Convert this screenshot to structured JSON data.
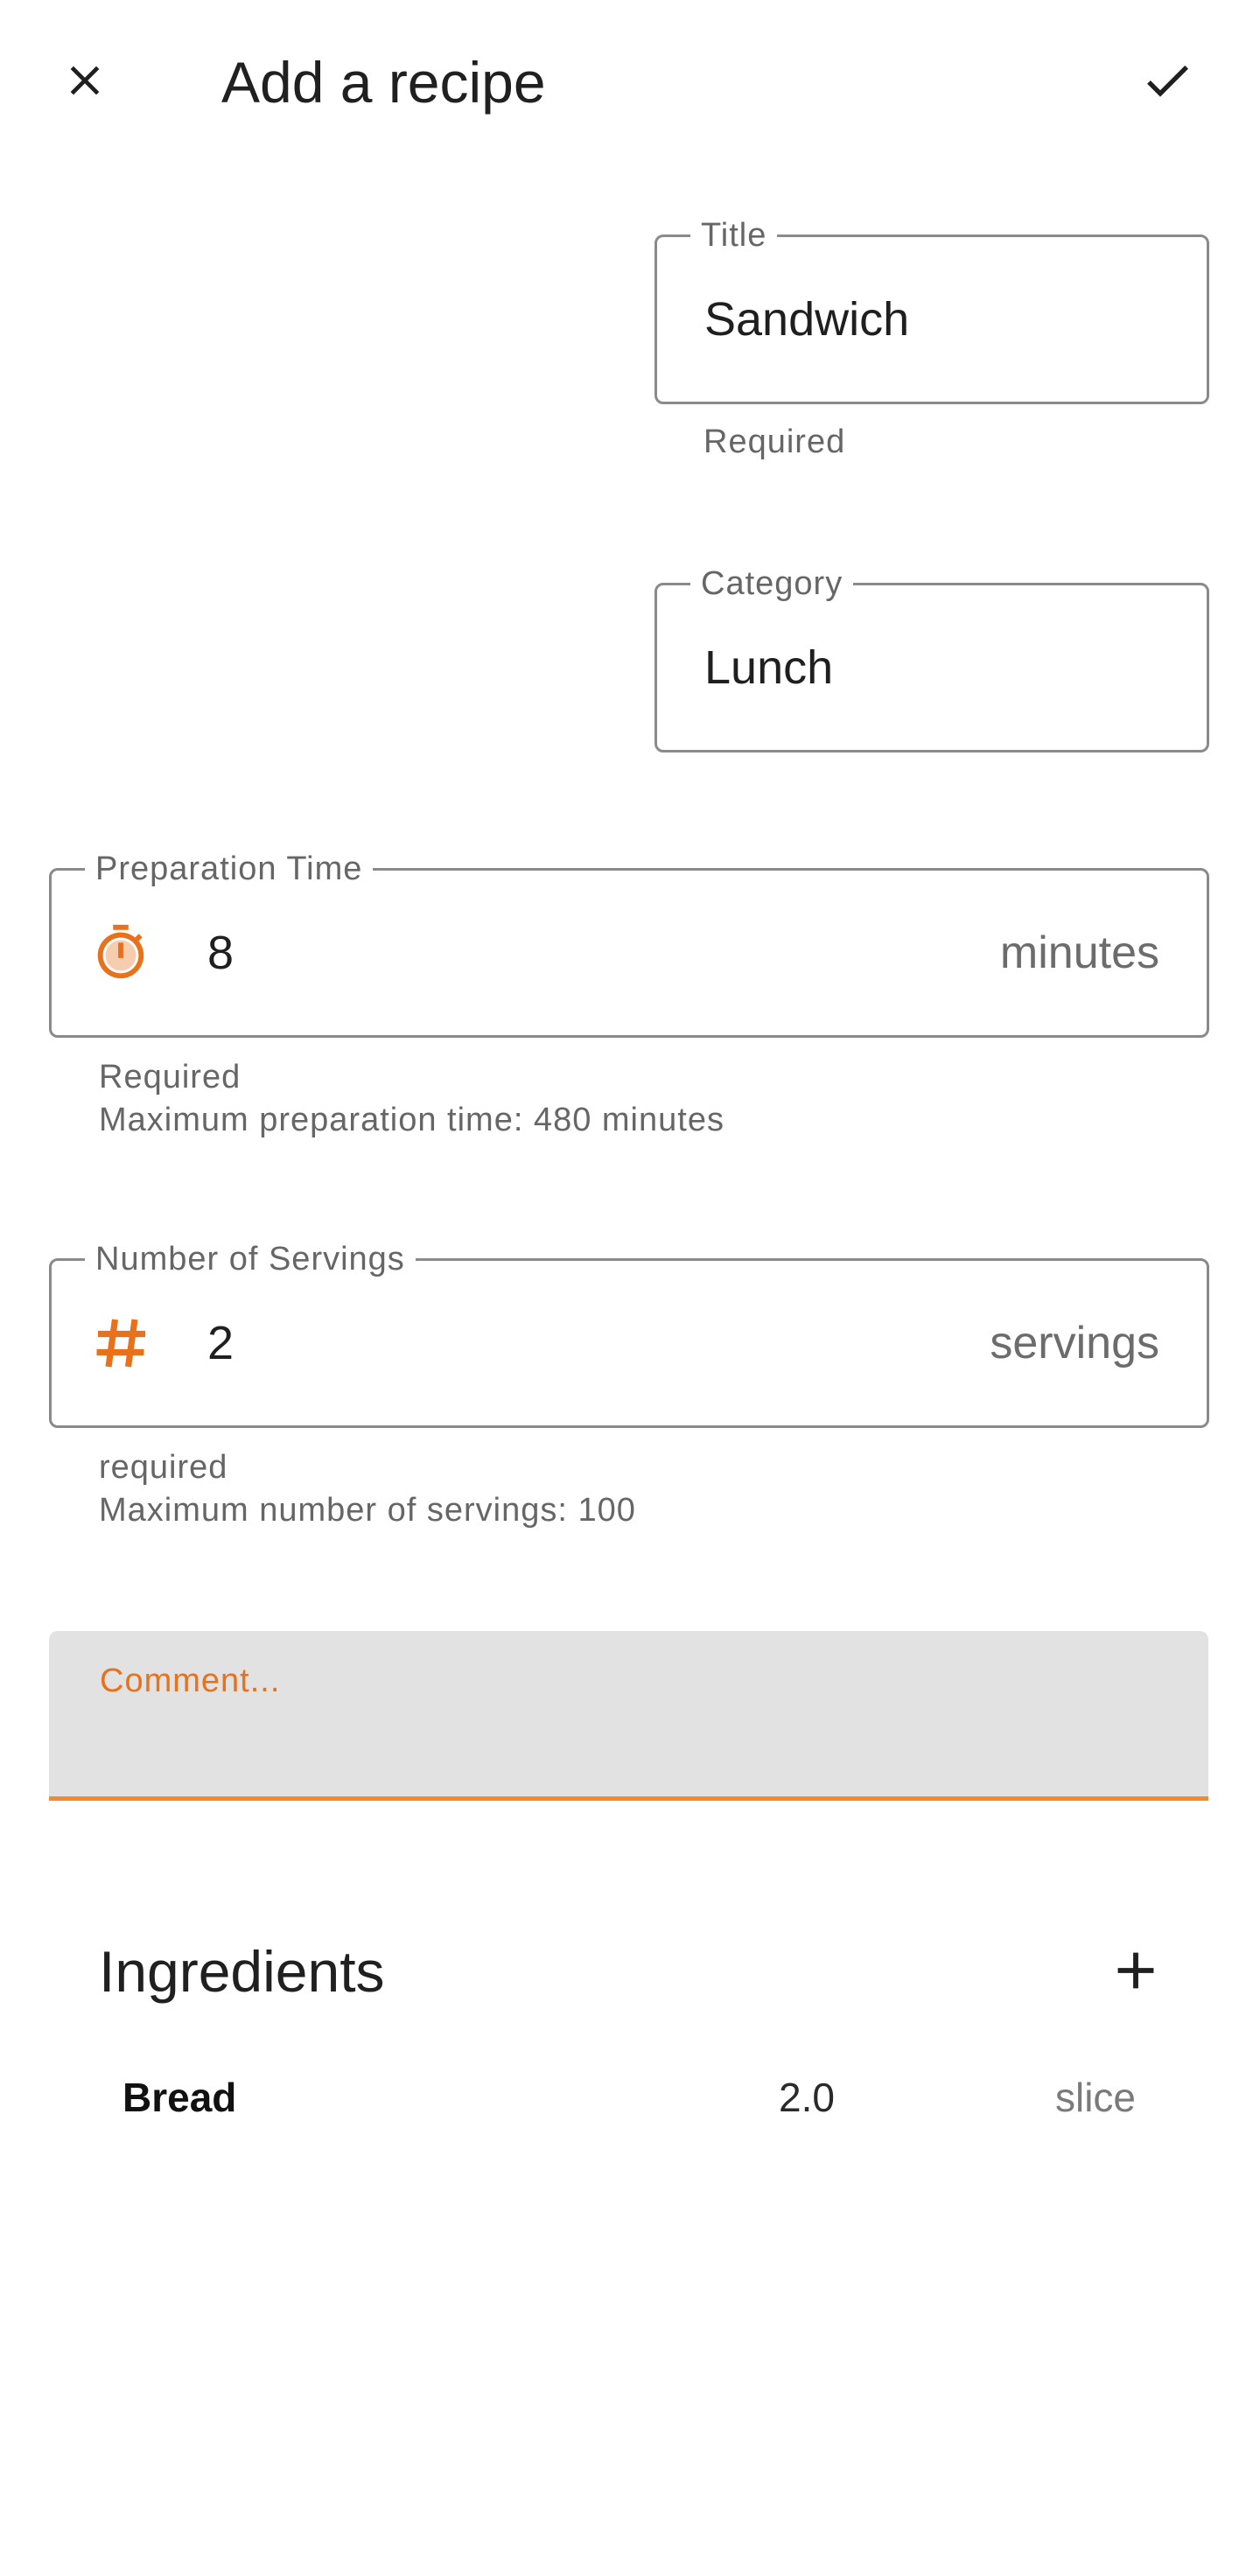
{
  "appbar": {
    "title": "Add a recipe",
    "close_icon": "close-icon",
    "confirm_icon": "check-icon"
  },
  "form": {
    "title_field": {
      "label": "Title",
      "value": "Sandwich",
      "helper": "Required"
    },
    "category_field": {
      "label": "Category",
      "value": "Lunch"
    },
    "prep_time_field": {
      "label": "Preparation Time",
      "value": "8",
      "suffix": "minutes",
      "icon": "timer-icon",
      "helper_1": "Required",
      "helper_2": "Maximum preparation time: 480 minutes"
    },
    "servings_field": {
      "label": "Number of Servings",
      "value": "2",
      "suffix": "servings",
      "icon": "hash-icon",
      "helper_1": "required",
      "helper_2": "Maximum number of servings: 100"
    },
    "comment_field": {
      "placeholder": "Comment..."
    }
  },
  "ingredients": {
    "title": "Ingredients",
    "add_icon": "plus-icon",
    "items": [
      {
        "name": "Bread",
        "quantity": "2.0",
        "unit": "slice"
      }
    ]
  },
  "colors": {
    "accent": "#e8711c",
    "outline": "#8a8a8a",
    "filled_bg": "#e2e2e2"
  }
}
